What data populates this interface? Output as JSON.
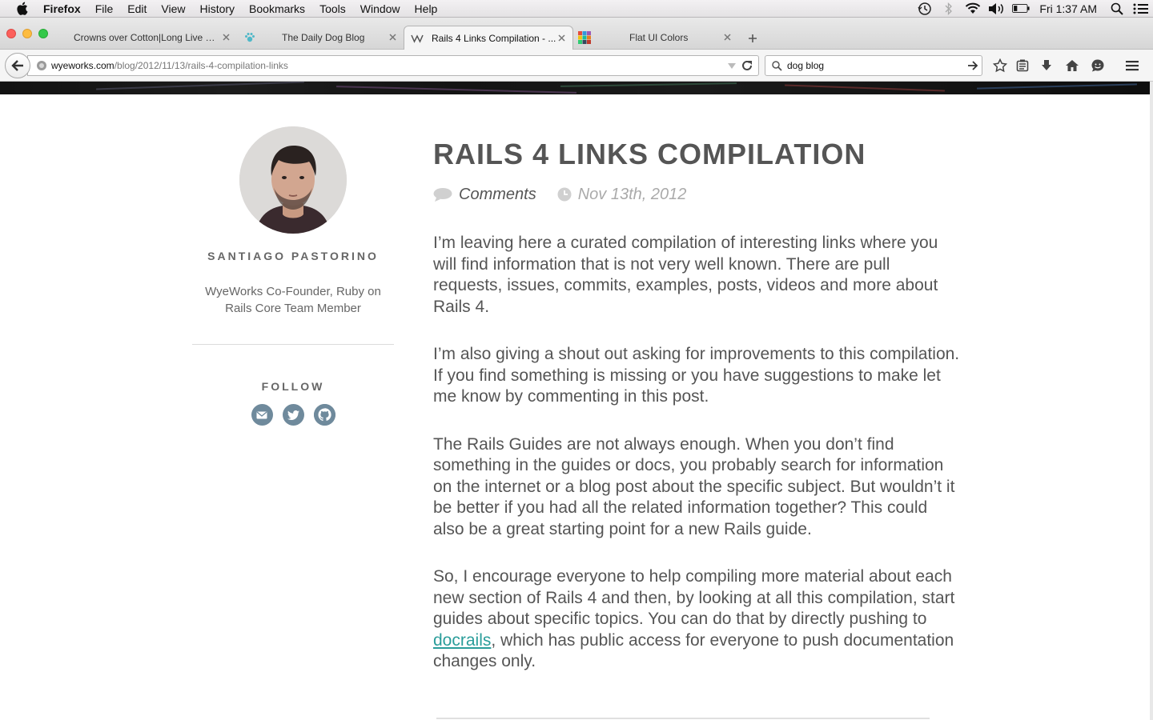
{
  "menubar": {
    "app_name": "Firefox",
    "items": [
      "File",
      "Edit",
      "View",
      "History",
      "Bookmarks",
      "Tools",
      "Window",
      "Help"
    ],
    "clock": "Fri 1:37 AM",
    "status_icons": [
      "time-machine-icon",
      "bluetooth-icon",
      "wifi-icon",
      "volume-icon",
      "battery-icon",
      "spotlight-icon",
      "notification-center-icon"
    ]
  },
  "tabs": [
    {
      "title": "Crowns over Cotton|Long Live C...",
      "favicon": "none",
      "active": false
    },
    {
      "title": "The Daily Dog Blog",
      "favicon": "paw-icon",
      "active": false
    },
    {
      "title": "Rails 4 Links Compilation - ...",
      "favicon": "wyeworks-icon",
      "active": true
    },
    {
      "title": "Flat UI Colors",
      "favicon": "color-grid-icon",
      "active": false
    }
  ],
  "navbar": {
    "url_host": "wyeworks.com",
    "url_path": "/blog/2012/11/13/rails-4-compilation-links",
    "search_value": "dog blog"
  },
  "sidebar": {
    "author_name": "SANTIAGO PASTORINO",
    "author_bio": "WyeWorks Co-Founder, Ruby on Rails Core Team Member",
    "follow_label": "FOLLOW",
    "social": [
      "email-icon",
      "twitter-icon",
      "github-icon"
    ]
  },
  "post": {
    "title": "RAILS 4 LINKS COMPILATION",
    "comments_label": "Comments",
    "date": "Nov 13th, 2012",
    "paragraphs": [
      "I’m leaving here a curated compilation of interesting links where you will find information that is not very well known. There are pull requests, issues, commits, examples, posts, videos and more about Rails 4.",
      "I’m also giving a shout out asking for improvements to this compilation. If you find something is missing or you have suggestions to make let me know by commenting in this post.",
      "The Rails Guides are not always enough. When you don’t find something in the guides or docs, you probably search for information on the internet or a blog post about the specific subject. But wouldn’t it be better if you had all the related information together? This could also be a great starting point for a new Rails guide."
    ],
    "p4_before": "So, I encourage everyone to help compiling more material about each new section of Rails 4 and then, by looking at all this compilation, start guides about specific topics. You can do that by directly pushing to ",
    "p4_link": "docrails",
    "p4_after": ", which has public access for everyone to push documentation changes only.",
    "link_color": "#2a9d9a"
  }
}
